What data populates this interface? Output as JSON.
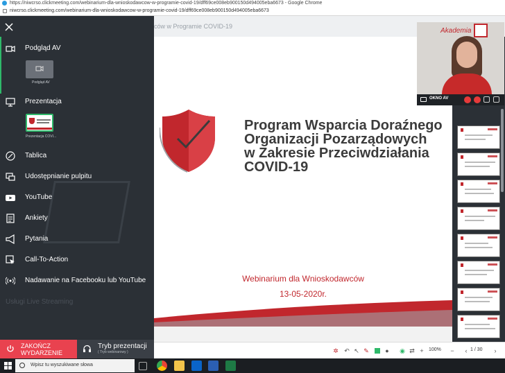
{
  "browser": {
    "title": "https://niwcrso.clickmeeting.com/webinarium-dla-wnioskodawcow-w-programie-covid-19/dff69ce008eb900150d494005eba6673 - Google Chrome",
    "url": "niwcrso.clickmeeting.com/webinarium-dla-wnioskodawcow-w-programie-covid-19/dff69ce008eb900150d494005eba6673"
  },
  "header": {
    "room_title": "ców w Programie COVID-19"
  },
  "panel": {
    "items": [
      {
        "label": "Podgląd AV",
        "icon": "camera-icon"
      },
      {
        "label": "Prezentacja",
        "icon": "presentation-icon"
      },
      {
        "label": "Tablica",
        "icon": "pen-icon"
      },
      {
        "label": "Udostępnianie pulpitu",
        "icon": "screen-share-icon"
      },
      {
        "label": "YouTube",
        "icon": "youtube-icon"
      },
      {
        "label": "Ankiety",
        "icon": "poll-icon"
      },
      {
        "label": "Pytania",
        "icon": "megaphone-icon"
      },
      {
        "label": "Call-To-Action",
        "icon": "cta-icon"
      },
      {
        "label": "Nadawanie na Facebooku lub YouTube",
        "icon": "broadcast-icon"
      }
    ],
    "av_tile_caption": "Podgląd AV",
    "presentation_tile_caption": "Prezentacja COVI...",
    "faded_item": "Usługi Live Streaming",
    "end_button": {
      "line1": "ZAKOŃCZ",
      "line2": "WYDARZENIE"
    },
    "mode_button": {
      "label": "Tryb prezentacji",
      "sub": "( Tryb webinarowy )"
    }
  },
  "slide": {
    "title_lines": [
      "Program Wsparcia Doraźnego",
      "Organizacji Pozarządowych",
      "w Zakresie Przeciwdziałania",
      "COVID-19"
    ],
    "subtitle": "Webinarium dla Wnioskodawców",
    "date": "13-05-2020r.",
    "accent_color": "#c1272d"
  },
  "video": {
    "logo_text": "Akademia",
    "logo_mark": "NIW",
    "label": "OKNO AV"
  },
  "toolbar": {
    "zoom": "100%",
    "pages": "1 / 30"
  },
  "taskbar": {
    "search_placeholder": "Wpisz tu wyszukiwane słowa"
  }
}
